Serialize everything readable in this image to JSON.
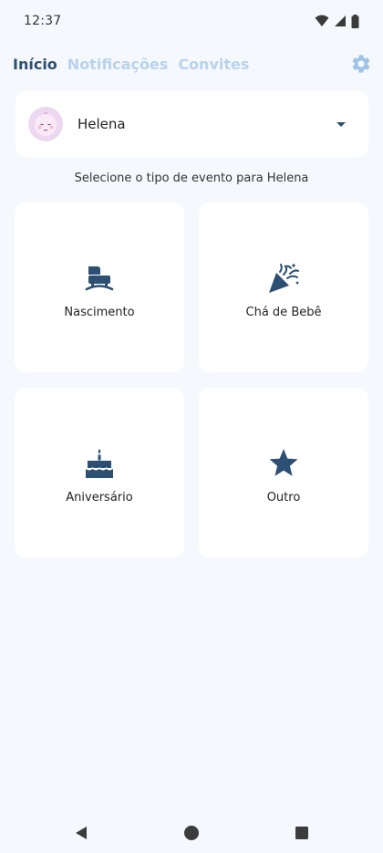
{
  "status_bar": {
    "time": "12:37",
    "icons": [
      "wifi-icon",
      "signal-icon",
      "battery-icon"
    ]
  },
  "nav": {
    "tabs": [
      {
        "label": "Início",
        "active": true
      },
      {
        "label": "Notificações",
        "active": false
      },
      {
        "label": "Convites",
        "active": false
      }
    ],
    "settings_icon": "gear-icon"
  },
  "profile": {
    "name": "Helena",
    "avatar_icon": "baby-face-icon",
    "dropdown_icon": "caret-down-icon"
  },
  "prompt": "Selecione o tipo de evento para Helena",
  "events": [
    {
      "label": "Nascimento",
      "icon": "baby-carriage-icon"
    },
    {
      "label": "Chá de Bebê",
      "icon": "party-popper-icon"
    },
    {
      "label": "Aniversário",
      "icon": "birthday-cake-icon"
    },
    {
      "label": "Outro",
      "icon": "star-icon"
    }
  ],
  "colors": {
    "primary": "#2c4f72",
    "tab_inactive": "#b7d3ee",
    "background": "#f5f8fc",
    "card": "#ffffff",
    "icon": "#2c4f72"
  },
  "system_nav": [
    "back-icon",
    "home-icon",
    "recents-icon"
  ]
}
